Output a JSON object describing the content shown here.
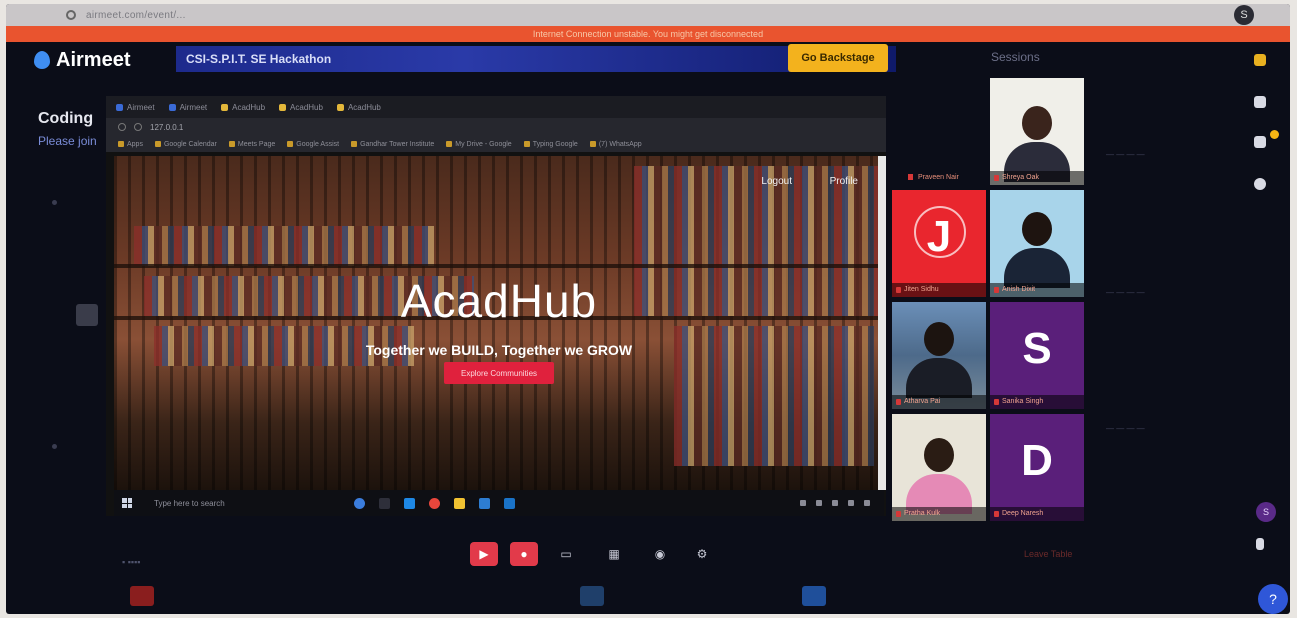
{
  "browser": {
    "url": "airmeet.com/event/...",
    "user_initial": "S"
  },
  "warning": {
    "text": "Internet Connection unstable. You might get disconnected"
  },
  "header": {
    "brand": "Airmeet",
    "event_name": "CSI-S.P.I.T. SE Hackathon",
    "backstage_label": "Go Backstage",
    "sessions_label": "Sessions"
  },
  "session": {
    "title": "Coding",
    "subtitle": "Please join"
  },
  "shared_screen": {
    "tabs": [
      "Airmeet",
      "Airmeet",
      "AcadHub",
      "AcadHub",
      "AcadHub"
    ],
    "omnibox_url": "127.0.0.1",
    "bookmarks": [
      "Apps",
      "Google Calendar",
      "Meets Page",
      "Google Assist",
      "Gandhar Tower Institute",
      "My Drive - Google",
      "Typing Google",
      "(7) WhatsApp"
    ],
    "nav": {
      "logout": "Logout",
      "profile": "Profile"
    },
    "hero": {
      "title": "AcadHub",
      "subtitle": "Together we BUILD, Together we GROW",
      "button": "Explore Communities"
    },
    "taskbar": {
      "search_placeholder": "Type here to search"
    }
  },
  "participants": [
    {
      "name": "Praveen Nair",
      "type": "label"
    },
    {
      "name": "Shreya Oak",
      "type": "video"
    },
    {
      "name": "Jiten Sidhu",
      "type": "letter",
      "letter": "J",
      "color": "#e9262e"
    },
    {
      "name": "Anish Dixit",
      "type": "video"
    },
    {
      "name": "Atharva Pai",
      "type": "video"
    },
    {
      "name": "Sanika Singh",
      "type": "letter",
      "letter": "S",
      "color": "#5a1f7a"
    },
    {
      "name": "Pratha Kulk",
      "type": "video"
    },
    {
      "name": "Deep Naresh",
      "type": "letter",
      "letter": "D",
      "color": "#5a1f7a"
    }
  ],
  "sidebar": {
    "icons": [
      "users-icon",
      "chat-icon",
      "question-icon",
      "exit-icon"
    ],
    "avatar_initial": "S",
    "help": "?"
  },
  "bottom": {
    "leave_label": "Leave Table"
  },
  "colors": {
    "accent": "#e23a4a",
    "brand": "#3f8ef2",
    "backstage": "#f3b21d",
    "warning": "#e9542f"
  }
}
